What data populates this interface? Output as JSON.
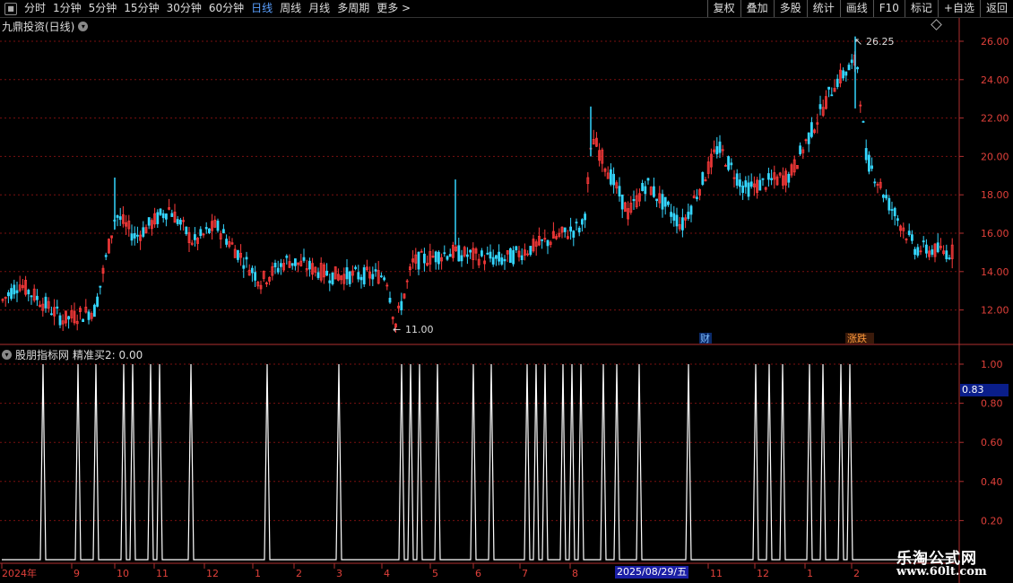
{
  "toolbar": {
    "periods": [
      "分时",
      "1分钟",
      "5分钟",
      "15分钟",
      "30分钟",
      "60分钟",
      "日线",
      "周线",
      "月线",
      "多周期",
      "更多 >"
    ],
    "active_index": 6,
    "right_buttons": [
      "复权",
      "叠加",
      "多股",
      "统计",
      "画线",
      "F10",
      "标记",
      "+自选",
      "返回"
    ]
  },
  "main_chart": {
    "title": "九鼎投资(日线)",
    "y_ticks": [
      "26.00",
      "24.00",
      "22.00",
      "20.00",
      "18.00",
      "16.00",
      "14.00",
      "12.00"
    ],
    "high_label": "26.25",
    "low_label": "11.00",
    "markers": [
      "财",
      "涨跌"
    ],
    "colors": {
      "up": "#ff3b3b",
      "down": "#34d6ff",
      "grid": "#7a1010",
      "axis": "#b03030"
    }
  },
  "indicator": {
    "title": "股朋指标网",
    "value_text": "精准买2: 0.00",
    "y_ticks": [
      "1.00",
      "0.80",
      "0.60",
      "0.40",
      "0.20"
    ],
    "current_value": "0.83"
  },
  "x_axis": {
    "labels": [
      "2024年",
      "9",
      "10",
      "11",
      "12",
      "1",
      "2",
      "3",
      "4",
      "5",
      "6",
      "7",
      "8",
      "11",
      "12",
      "1",
      "2"
    ],
    "selected_date": "2025/08/29/五"
  },
  "watermark": {
    "name": "乐淘公式网",
    "url": "www.60lt.com"
  }
}
